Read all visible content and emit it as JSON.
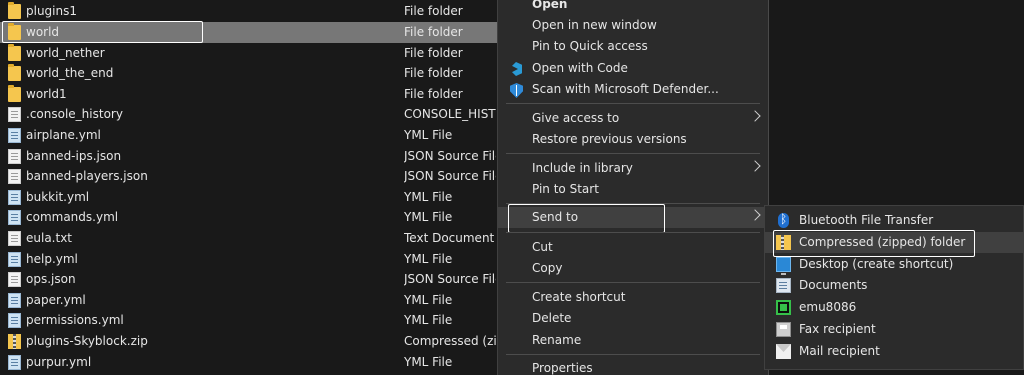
{
  "files": [
    {
      "name": "plugins1",
      "type": "File folder",
      "icon": "folder-icon"
    },
    {
      "name": "world",
      "type": "File folder",
      "icon": "folder-icon"
    },
    {
      "name": "world_nether",
      "type": "File folder",
      "icon": "folder-icon"
    },
    {
      "name": "world_the_end",
      "type": "File folder",
      "icon": "folder-icon"
    },
    {
      "name": "world1",
      "type": "File folder",
      "icon": "folder-icon"
    },
    {
      "name": ".console_history",
      "type": "CONSOLE_HISTORY",
      "icon": "document-icon"
    },
    {
      "name": "airplane.yml",
      "type": "YML File",
      "icon": "yml-file-icon"
    },
    {
      "name": "banned-ips.json",
      "type": "JSON Source File",
      "icon": "document-icon"
    },
    {
      "name": "banned-players.json",
      "type": "JSON Source File",
      "icon": "document-icon"
    },
    {
      "name": "bukkit.yml",
      "type": "YML File",
      "icon": "yml-file-icon"
    },
    {
      "name": "commands.yml",
      "type": "YML File",
      "icon": "yml-file-icon"
    },
    {
      "name": "eula.txt",
      "type": "Text Document",
      "icon": "document-icon"
    },
    {
      "name": "help.yml",
      "type": "YML File",
      "icon": "yml-file-icon"
    },
    {
      "name": "ops.json",
      "type": "JSON Source File",
      "icon": "document-icon"
    },
    {
      "name": "paper.yml",
      "type": "YML File",
      "icon": "yml-file-icon"
    },
    {
      "name": "permissions.yml",
      "type": "YML File",
      "icon": "yml-file-icon"
    },
    {
      "name": "plugins-Skyblock.zip",
      "type": "Compressed (zipped)",
      "icon": "zip-icon"
    },
    {
      "name": "purpur.yml",
      "type": "YML File",
      "icon": "yml-file-icon"
    }
  ],
  "context_menu": {
    "open": "Open",
    "open_new_window": "Open in new window",
    "pin_quick_access": "Pin to Quick access",
    "open_with_code": "Open with Code",
    "scan_defender": "Scan with Microsoft Defender...",
    "give_access": "Give access to",
    "restore_versions": "Restore previous versions",
    "include_library": "Include in library",
    "pin_start": "Pin to Start",
    "send_to": "Send to",
    "cut": "Cut",
    "copy": "Copy",
    "create_shortcut": "Create shortcut",
    "delete": "Delete",
    "rename": "Rename",
    "properties": "Properties"
  },
  "send_to_menu": {
    "bluetooth": "Bluetooth File Transfer",
    "compressed": "Compressed (zipped) folder",
    "desktop": "Desktop (create shortcut)",
    "documents": "Documents",
    "emu": "emu8086",
    "fax": "Fax recipient",
    "mail": "Mail recipient"
  },
  "colors": {
    "background": "#191919",
    "menu_background": "#2b2b2b",
    "hover_row": "#777777",
    "highlight_outline": "#ffffff"
  }
}
